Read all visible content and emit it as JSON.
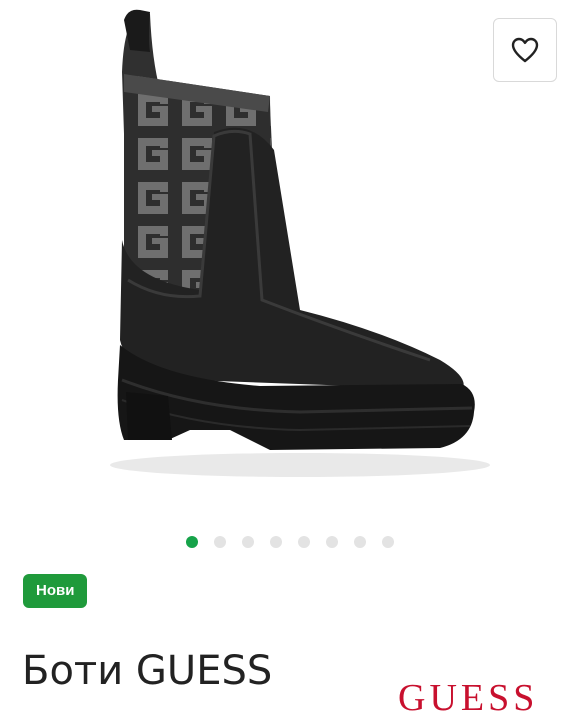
{
  "product": {
    "badge": "Нови",
    "title": "Боти GUESS",
    "brand_logo": "GUESS",
    "image_alt": "black platform ankle boot with knit logo shaft"
  },
  "favorite": {
    "icon": "heart-outline-icon"
  },
  "carousel": {
    "total": 8,
    "active_index": 0
  },
  "colors": {
    "accent_green": "#1f9a3b",
    "dot_inactive": "#e3e3e3",
    "brand_red": "#c8102e"
  }
}
